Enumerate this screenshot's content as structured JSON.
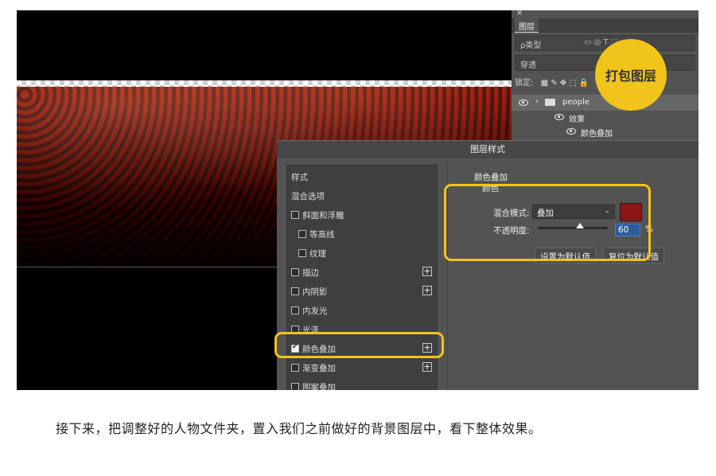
{
  "layers_panel": {
    "close": "×",
    "tab": "图层",
    "filter_kind": "ρ类型",
    "blend_mode": "穿透",
    "lock_label": "锁定:",
    "layers": [
      {
        "name": "people",
        "visible": true,
        "type": "folder"
      },
      {
        "name": "效果",
        "visible": true,
        "type": "effects"
      },
      {
        "name": "颜色叠加",
        "visible": true,
        "type": "effect"
      }
    ]
  },
  "badge": {
    "text": "打包图层"
  },
  "dialog": {
    "title": "图层样式",
    "style_list": [
      {
        "label": "样式",
        "header": true
      },
      {
        "label": "混合选项",
        "header": true
      },
      {
        "label": "斜面和浮雕",
        "checked": false
      },
      {
        "label": "等高线",
        "checked": false,
        "indent": true
      },
      {
        "label": "纹理",
        "checked": false,
        "indent": true
      },
      {
        "label": "描边",
        "checked": false,
        "plus": "+"
      },
      {
        "label": "内阴影",
        "checked": false,
        "plus": "+"
      },
      {
        "label": "内发光",
        "checked": false
      },
      {
        "label": "光泽",
        "checked": false
      },
      {
        "label": "颜色叠加",
        "checked": true,
        "plus": "+"
      },
      {
        "label": "渐变叠加",
        "checked": false,
        "plus": "+"
      },
      {
        "label": "图案叠加",
        "checked": false
      }
    ],
    "color_overlay": {
      "section_title": "颜色叠加",
      "section_sub": "颜色",
      "blend_mode_label": "混合模式:",
      "blend_mode_value": "叠加",
      "caret": "⌄",
      "color": "#8f1515",
      "opacity_label": "不透明度:",
      "opacity_value": "60",
      "opacity_unit": "%",
      "opacity_fraction": 0.6,
      "set_default": "设置为默认值",
      "reset_default": "复位为默认值"
    }
  },
  "highlight_color": "#f0c41b",
  "caption": "接下来，把调整好的人物文件夹，置入我们之前做好的背景图层中，看下整体效果。"
}
